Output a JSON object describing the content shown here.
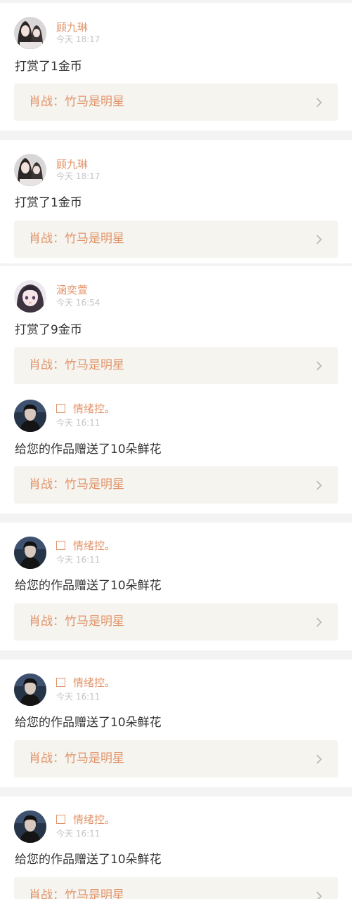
{
  "notifications": [
    {
      "user": "顾九琳",
      "time": "今天 18:17",
      "message": "打赏了1金币",
      "work": "肖战：竹马是明星",
      "avatar": "avatar-girls"
    },
    {
      "user": "顾九琳",
      "time": "今天 18:17",
      "message": "打赏了1金币",
      "work": "肖战：竹马是明星",
      "avatar": "avatar-girls"
    },
    {
      "user": "涵奕萱",
      "time": "今天 16:54",
      "message": "打赏了9金币",
      "work": "肖战：竹马是明星",
      "avatar": "avatar-anime-girl"
    },
    {
      "user": "情绪控。",
      "time": "今天 16:11",
      "message": "给您的作品赠送了10朵鲜花",
      "work": "肖战：竹马是明星",
      "avatar": "avatar-boy"
    },
    {
      "user": "情绪控。",
      "time": "今天 16:11",
      "message": "给您的作品赠送了10朵鲜花",
      "work": "肖战：竹马是明星",
      "avatar": "avatar-boy"
    },
    {
      "user": "情绪控。",
      "time": "今天 16:11",
      "message": "给您的作品赠送了10朵鲜花",
      "work": "肖战：竹马是明星",
      "avatar": "avatar-boy"
    },
    {
      "user": "情绪控。",
      "time": "今天 16:11",
      "message": "给您的作品赠送了10朵鲜花",
      "work": "肖战：竹马是明星",
      "avatar": "avatar-boy"
    }
  ],
  "icons": {
    "chevron": "chevron-right-icon",
    "name_prefix": "square-icon"
  },
  "colors": {
    "accent": "#e2946a",
    "text": "#333333",
    "muted": "#c4c4c4",
    "work_bg": "#f5f4ef",
    "separator": "#f3f3f3"
  }
}
